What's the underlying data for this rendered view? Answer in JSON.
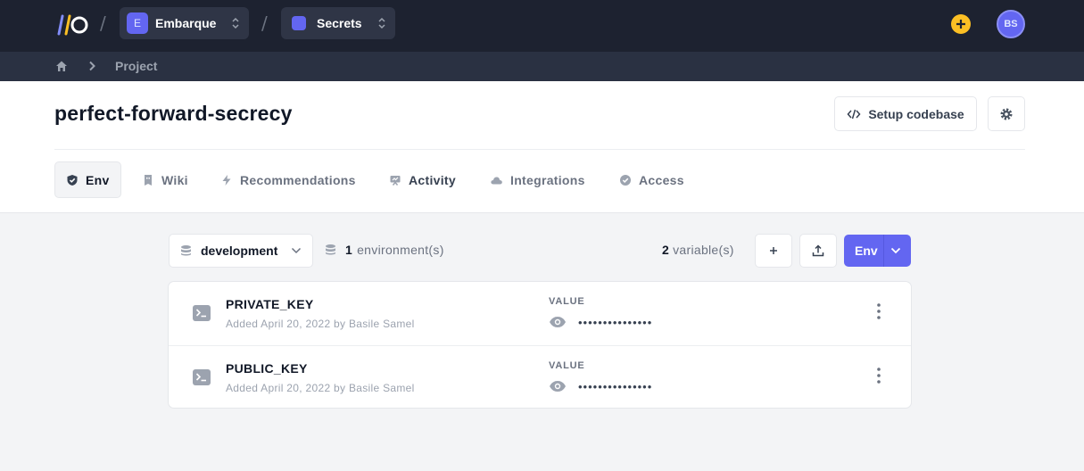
{
  "topbar": {
    "org": {
      "initial": "E",
      "name": "Embarque"
    },
    "app": {
      "name": "Secrets"
    },
    "user_initials": "BS",
    "accent": "#6366f1",
    "plus_color": "#fbbf24"
  },
  "breadcrumb": {
    "current": "Project"
  },
  "project": {
    "title": "perfect-forward-secrecy",
    "setup_label": "Setup codebase"
  },
  "tabs": [
    {
      "label": "Env",
      "icon": "shield-check-icon"
    },
    {
      "label": "Wiki",
      "icon": "book-icon"
    },
    {
      "label": "Recommendations",
      "icon": "lightning-icon"
    },
    {
      "label": "Activity",
      "icon": "presentation-icon"
    },
    {
      "label": "Integrations",
      "icon": "cloud-icon"
    },
    {
      "label": "Access",
      "icon": "badge-check-icon"
    }
  ],
  "controls": {
    "environment": "development",
    "env_count": "1",
    "env_count_label": "environment(s)",
    "var_count": "2",
    "var_count_label": "variable(s)",
    "env_button": "Env"
  },
  "variables": [
    {
      "name": "PRIVATE_KEY",
      "meta": "Added April 20, 2022 by Basile Samel",
      "value_label": "VALUE",
      "masked": "•••••••••••••••"
    },
    {
      "name": "PUBLIC_KEY",
      "meta": "Added April 20, 2022 by Basile Samel",
      "value_label": "VALUE",
      "masked": "•••••••••••••••"
    }
  ]
}
